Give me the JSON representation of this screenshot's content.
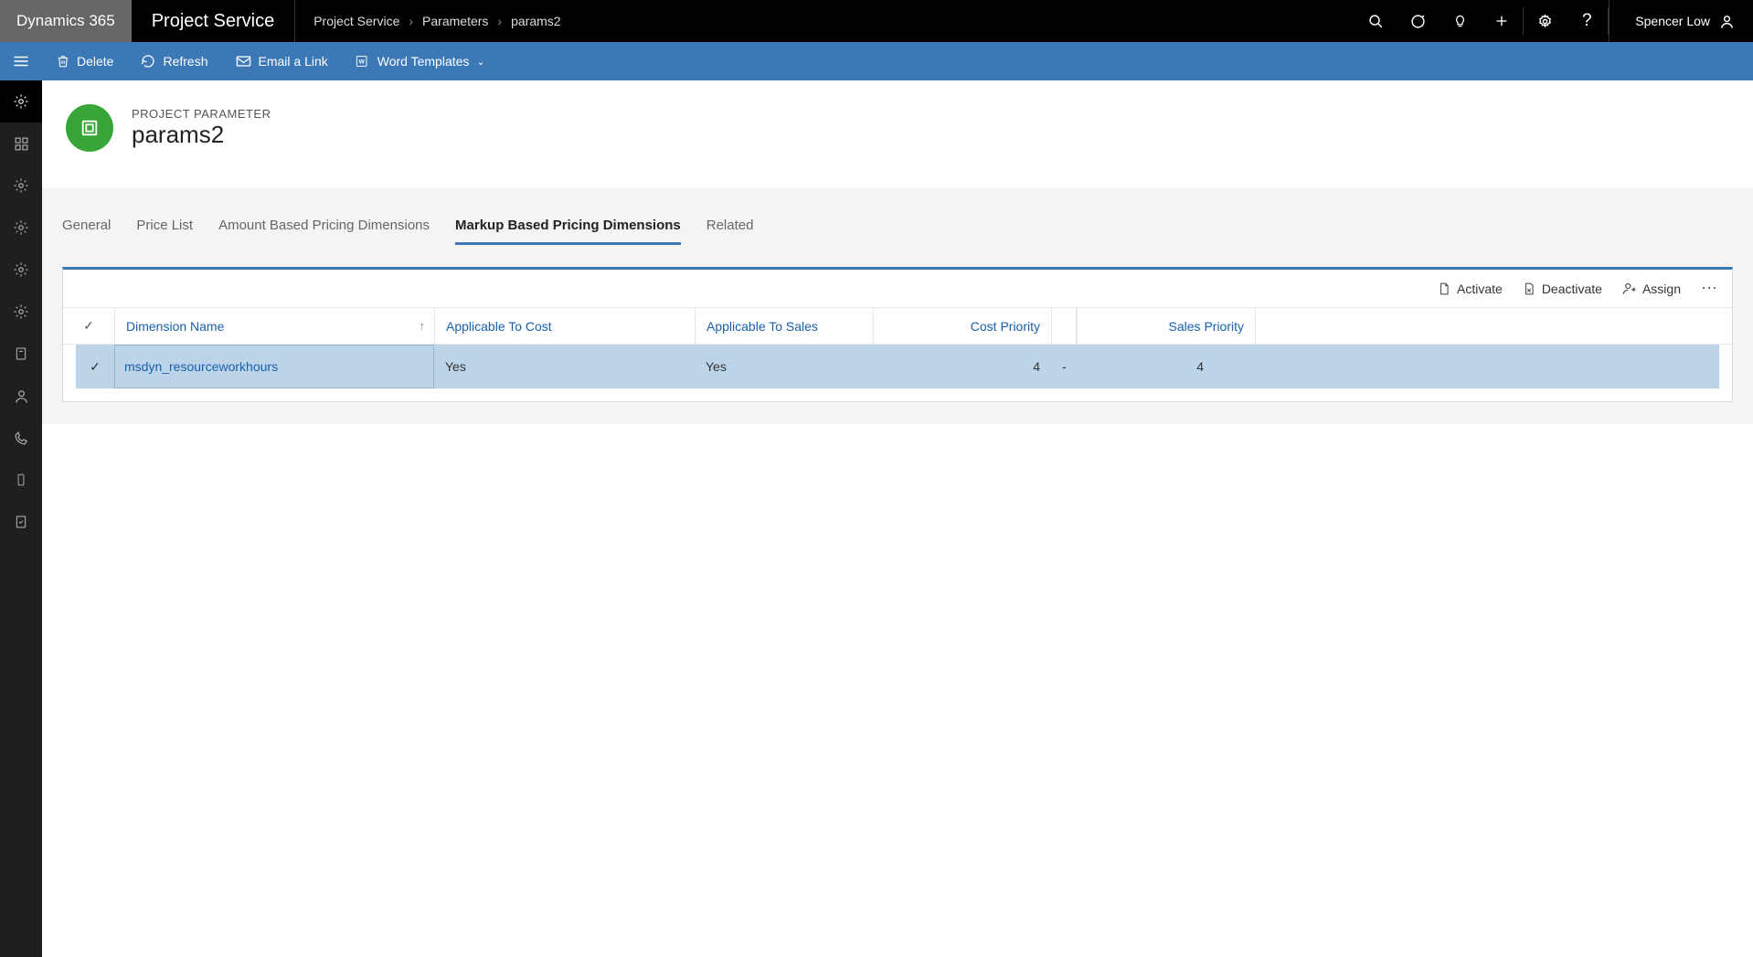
{
  "brand": "Dynamics 365",
  "app_name": "Project Service",
  "breadcrumb": {
    "a": "Project Service",
    "b": "Parameters",
    "c": "params2"
  },
  "user": "Spencer Low",
  "cmd": {
    "delete": "Delete",
    "refresh": "Refresh",
    "email": "Email a Link",
    "word": "Word Templates"
  },
  "entity": {
    "type": "PROJECT PARAMETER",
    "name": "params2"
  },
  "tabs": {
    "general": "General",
    "pricelist": "Price List",
    "amount": "Amount Based Pricing Dimensions",
    "markup": "Markup Based Pricing Dimensions",
    "related": "Related"
  },
  "grid": {
    "actions": {
      "activate": "Activate",
      "deactivate": "Deactivate",
      "assign": "Assign"
    },
    "headers": {
      "dim": "Dimension Name",
      "cost": "Applicable To Cost",
      "sales": "Applicable To Sales",
      "cprio": "Cost Priority",
      "sprio": "Sales Priority"
    },
    "rows": [
      {
        "dim": "msdyn_resourceworkhours",
        "cost": "Yes",
        "sales": "Yes",
        "cprio": "4",
        "dash": "-",
        "sprio": "4"
      }
    ]
  }
}
